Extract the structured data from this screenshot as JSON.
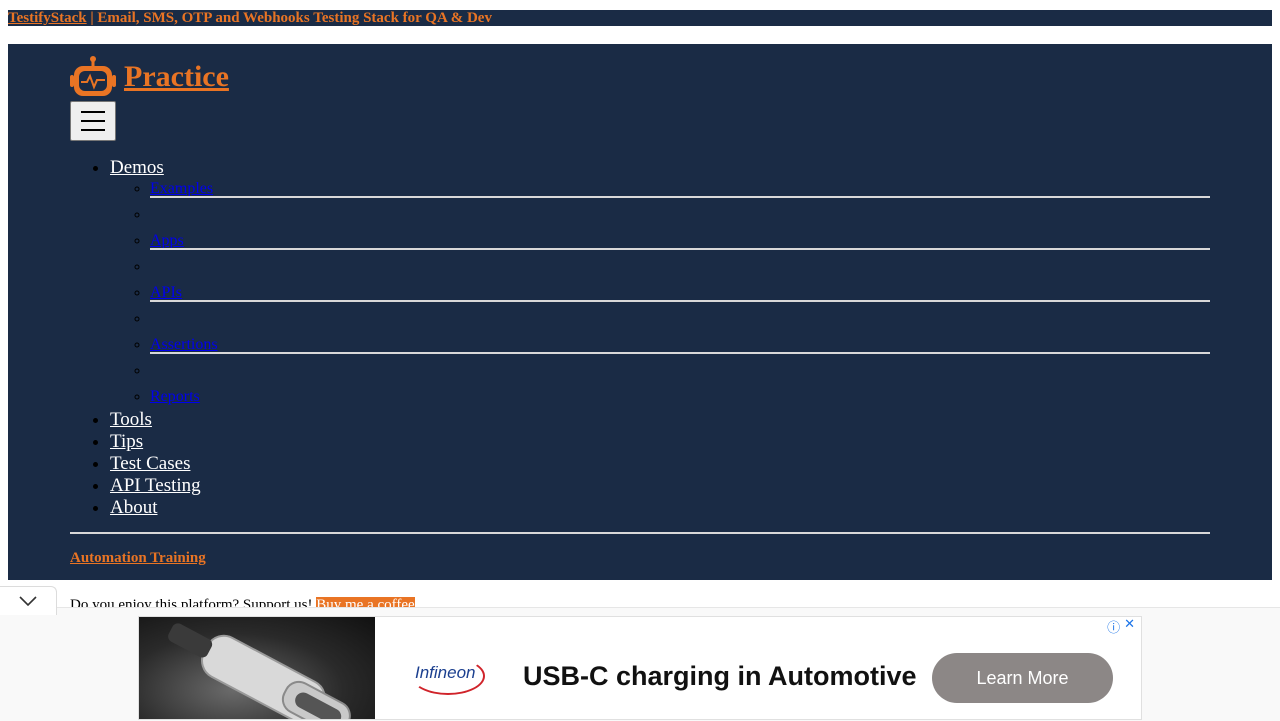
{
  "topbar": {
    "brand_link": "TestifyStack",
    "tagline": " | Email, SMS, OTP and Webhooks Testing Stack for QA & Dev"
  },
  "navbar": {
    "brand": "Practice",
    "toggler_icon": "hamburger-icon",
    "menu": {
      "demos": "Demos",
      "demos_sub": {
        "examples": "Examples",
        "apps": "Apps",
        "apis": "APIs",
        "assertions": "Assertions",
        "reports": "Reports"
      },
      "tools": "Tools",
      "tips": "Tips",
      "test_cases": "Test Cases",
      "api_testing": "API Testing",
      "about": "About"
    },
    "training": "Automation Training"
  },
  "support": {
    "text": "Do you enjoy this platform? Support us! ",
    "coffee": "Buy me a coffee"
  },
  "ad": {
    "logo": "Infineon",
    "headline": "USB-C charging in Automotive",
    "cta": "Learn More",
    "info_icon": "info-icon",
    "close_icon": "close-icon",
    "collapse_icon": "chevron-down-icon"
  },
  "colors": {
    "navy": "#1a2b45",
    "accent": "#e97424",
    "cta_gray": "#8c8786"
  }
}
